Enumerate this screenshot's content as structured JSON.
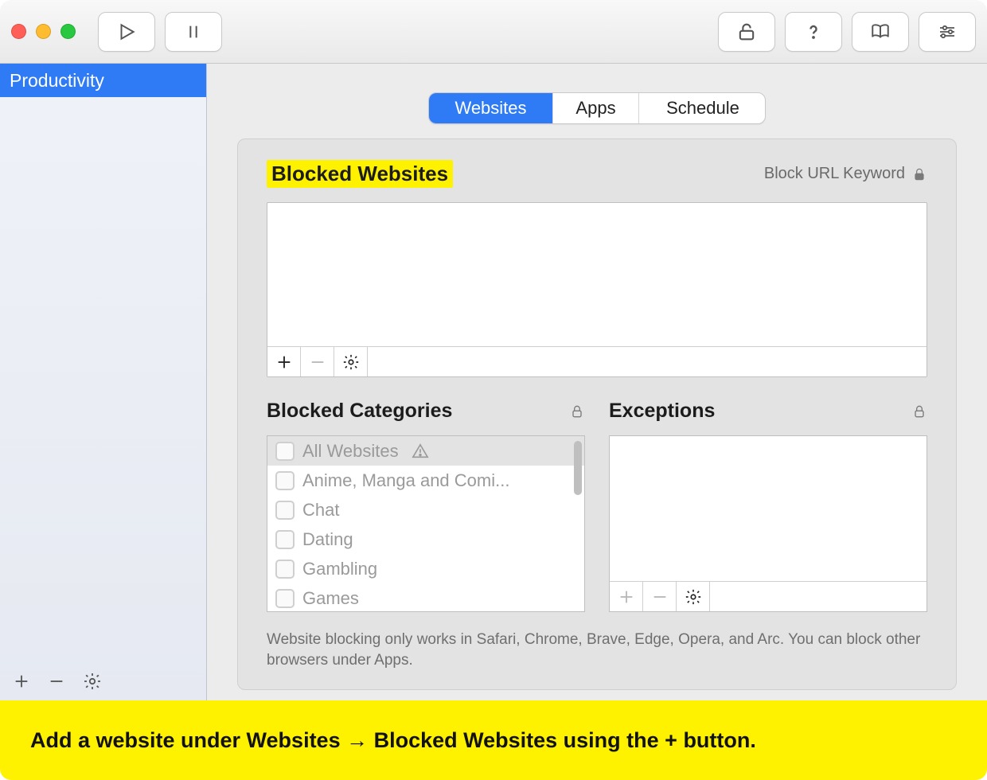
{
  "sidebar": {
    "items": [
      {
        "label": "Productivity"
      }
    ]
  },
  "tabs": {
    "websites": "Websites",
    "apps": "Apps",
    "schedule": "Schedule"
  },
  "blocked_websites": {
    "title": "Blocked Websites",
    "url_keyword_label": "Block URL Keyword"
  },
  "blocked_categories": {
    "title": "Blocked Categories",
    "items": [
      "All Websites",
      "Anime, Manga and Comi...",
      "Chat",
      "Dating",
      "Gambling",
      "Games"
    ]
  },
  "exceptions": {
    "title": "Exceptions"
  },
  "note": "Website blocking only works in Safari, Chrome, Brave, Edge, Opera, and Arc. You can block other browsers under Apps.",
  "banner": "Add a website under Websites → Blocked Websites using the + button."
}
